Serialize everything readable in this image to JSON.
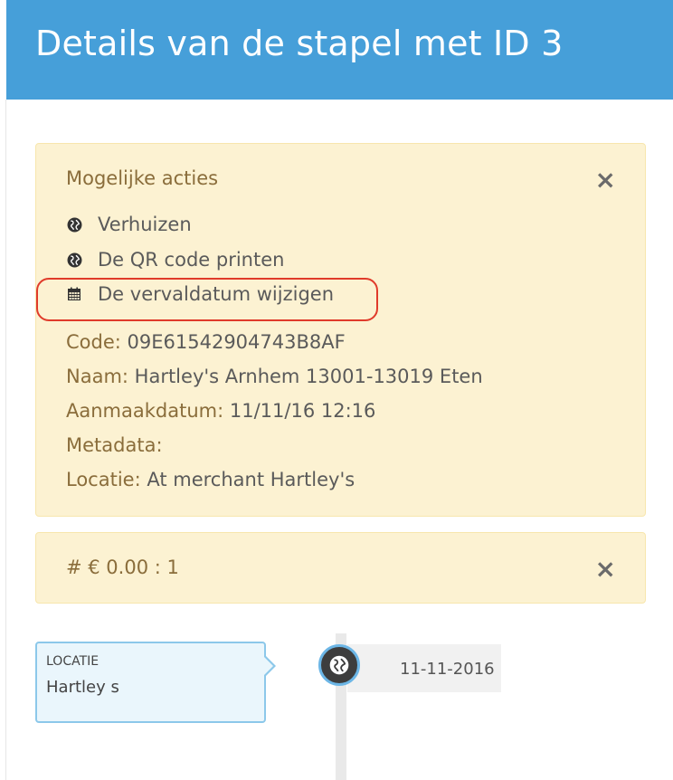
{
  "header": {
    "title": "Details van de stapel met ID 3"
  },
  "actions_alert": {
    "title": "Mogelijke acties",
    "close_label": "×",
    "actions": [
      {
        "label": "Verhuizen",
        "icon": "globe-icon"
      },
      {
        "label": "De QR code printen",
        "icon": "globe-icon"
      },
      {
        "label": "De vervaldatum wijzigen",
        "icon": "calendar-icon"
      }
    ],
    "highlight_color": "#e03b2b",
    "fields": [
      {
        "label": "Code:",
        "value": " 09E61542904743B8AF"
      },
      {
        "label": "Naam:",
        "value": " Hartley's Arnhem 13001-13019 Eten"
      },
      {
        "label": "Aanmaakdatum:",
        "value": " 11/11/16 12:16"
      },
      {
        "label": "Metadata:",
        "value": ""
      },
      {
        "label": "Locatie:",
        "value": " At merchant Hartley's"
      }
    ]
  },
  "price_alert": {
    "text": "# € 0.00 : 1",
    "close_label": "×"
  },
  "timeline": {
    "panel_title": "LOCATIE",
    "panel_body": "Hartley s",
    "date": "11-11-2016",
    "badge_icon": "globe-icon"
  },
  "colors": {
    "header_bg": "#469fd9",
    "alert_bg": "#fcf2d2",
    "alert_text": "#8a6d3b",
    "badge_border": "#6cb6e6"
  }
}
